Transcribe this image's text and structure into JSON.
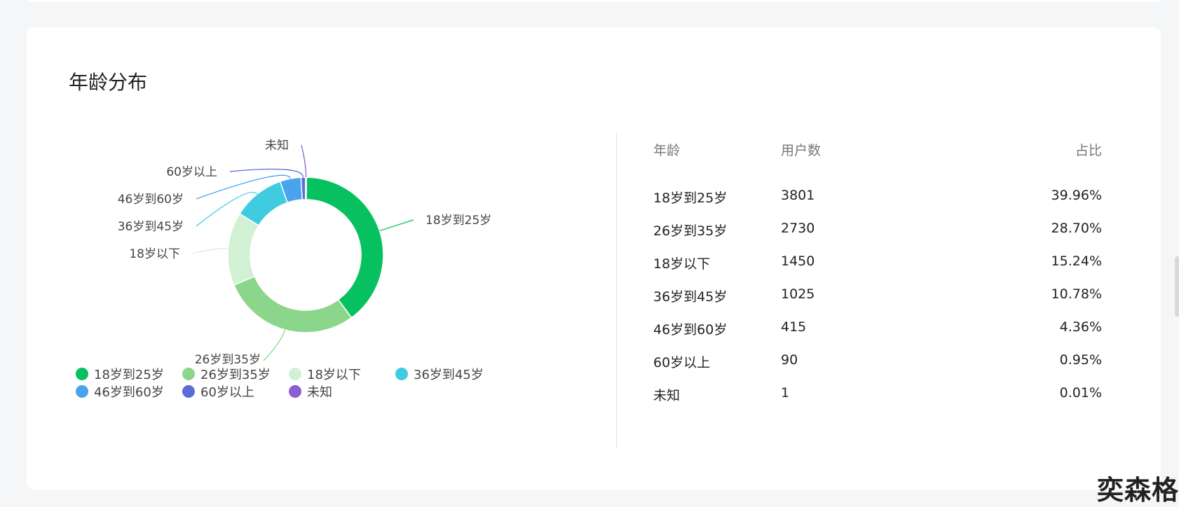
{
  "title": "年龄分布",
  "chart_data": {
    "type": "pie",
    "series": [
      {
        "name": "18岁到25岁",
        "value": 3801,
        "color": "#07c160"
      },
      {
        "name": "26岁到35岁",
        "value": 2730,
        "color": "#8cd68c"
      },
      {
        "name": "18岁以下",
        "value": 1450,
        "color": "#d2f0d4"
      },
      {
        "name": "36岁到45岁",
        "value": 1025,
        "color": "#3fcce0"
      },
      {
        "name": "46岁到60岁",
        "value": 415,
        "color": "#4aa3ee"
      },
      {
        "name": "60岁以上",
        "value": 90,
        "color": "#5a6ed6"
      },
      {
        "name": "未知",
        "value": 1,
        "color": "#8b5fcf"
      }
    ],
    "legend_position": "bottom"
  },
  "table": {
    "headers": [
      "年龄",
      "用户数",
      "占比"
    ],
    "rows": [
      [
        "18岁到25岁",
        "3801",
        "39.96%"
      ],
      [
        "26岁到35岁",
        "2730",
        "28.70%"
      ],
      [
        "18岁以下",
        "1450",
        "15.24%"
      ],
      [
        "36岁到45岁",
        "1025",
        "10.78%"
      ],
      [
        "46岁到60岁",
        "415",
        "4.36%"
      ],
      [
        "60岁以上",
        "90",
        "0.95%"
      ],
      [
        "未知",
        "1",
        "0.01%"
      ]
    ]
  },
  "watermark": "奕森格"
}
